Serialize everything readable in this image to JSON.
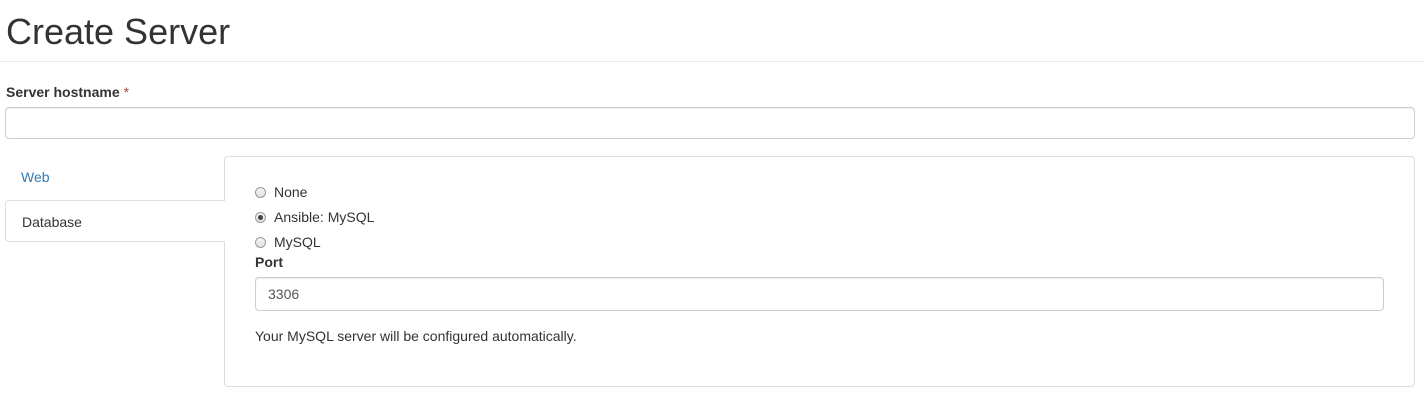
{
  "page": {
    "title": "Create Server"
  },
  "hostname": {
    "label": "Server hostname",
    "required_marker": "*",
    "value": "",
    "placeholder": ""
  },
  "tabs": [
    {
      "label": "Web",
      "active": false
    },
    {
      "label": "Database",
      "active": true
    }
  ],
  "database": {
    "options": [
      {
        "label": "None",
        "selected": false
      },
      {
        "label": "Ansible: MySQL",
        "selected": true
      },
      {
        "label": "MySQL",
        "selected": false
      }
    ],
    "port": {
      "label": "Port",
      "value": "3306"
    },
    "help_text": "Your MySQL server will be configured automatically."
  },
  "colors": {
    "link": "#337ab7",
    "required": "#a94442",
    "border": "#dddddd",
    "text": "#333333"
  }
}
